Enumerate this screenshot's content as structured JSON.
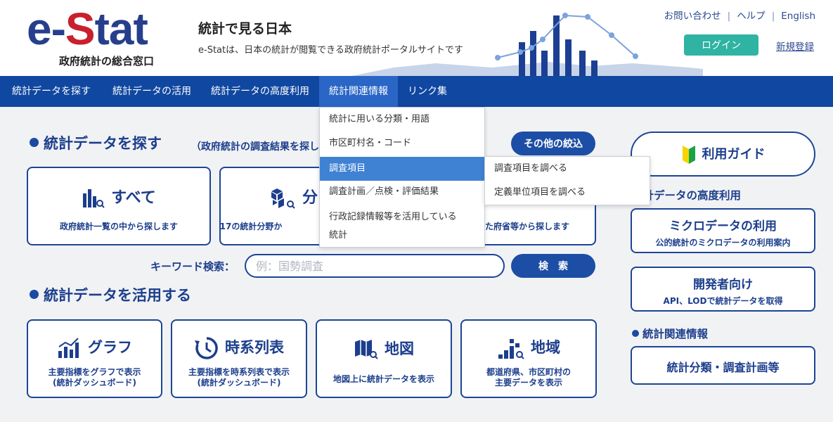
{
  "header": {
    "logo_main": "e-",
    "logo_s": "S",
    "logo_tail": "tat",
    "logo_sub": "政府統計の総合窓口",
    "site_title": "統計で見る日本",
    "site_desc": "e-Statは、日本の統計が閲覧できる政府統計ポータルサイトです",
    "links": [
      "お問い合わせ",
      "ヘルプ",
      "English"
    ],
    "login": "ログイン",
    "register": "新規登録"
  },
  "nav": {
    "items": [
      "統計データを探す",
      "統計データの活用",
      "統計データの高度利用",
      "統計関連情報",
      "リンク集"
    ]
  },
  "dropdown": {
    "items": [
      "統計に用いる分類・用語",
      "市区町村名・コード",
      "調査項目",
      "調査計画／点検・評価結果",
      "行政記録情報等を活用している",
      "統計"
    ],
    "sub_items": [
      "調査項目を調べる",
      "定義単位項目を調べる"
    ]
  },
  "search_section": {
    "title": "統計データを探す",
    "note": "（政府統計の調査結果を探し",
    "filter_button": "その他の絞込",
    "cards": [
      {
        "title": "すべて",
        "desc": "政府統計一覧の中から探します"
      },
      {
        "title": "分",
        "desc": "17の統計分野か"
      },
      {
        "title": "",
        "desc": "した府省等から探します"
      }
    ],
    "keyword_label": "キーワード検索：",
    "keyword_placeholder": "例：国勢調査",
    "search_button": "検　索"
  },
  "use_section": {
    "title": "統計データを活用する",
    "cards": [
      {
        "title": "グラフ",
        "desc1": "主要指標をグラフで表示",
        "desc2": "(統計ダッシュボード)"
      },
      {
        "title": "時系列表",
        "desc1": "主要指標を時系列表で表示",
        "desc2": "(統計ダッシュボード)"
      },
      {
        "title": "地図",
        "desc1": "地図上に統計データを表示",
        "desc2": ""
      },
      {
        "title": "地域",
        "desc1": "都道府県、市区町村の",
        "desc2": "主要データを表示"
      }
    ]
  },
  "right": {
    "guide": "利用ガイド",
    "advanced_title": "統計データの高度利用",
    "micro_title": "ミクロデータの利用",
    "micro_desc": "公的統計のミクロデータの利用案内",
    "dev_title": "開発者向け",
    "dev_desc": "API、LODで統計データを取得",
    "related_title": "統計関連情報",
    "related_card": "統計分類・調査計画等"
  },
  "colors": {
    "nav_bg": "#1047a0",
    "accent": "#1c3e8c",
    "login": "#2fb3a2",
    "logo_red": "#c8202d"
  }
}
